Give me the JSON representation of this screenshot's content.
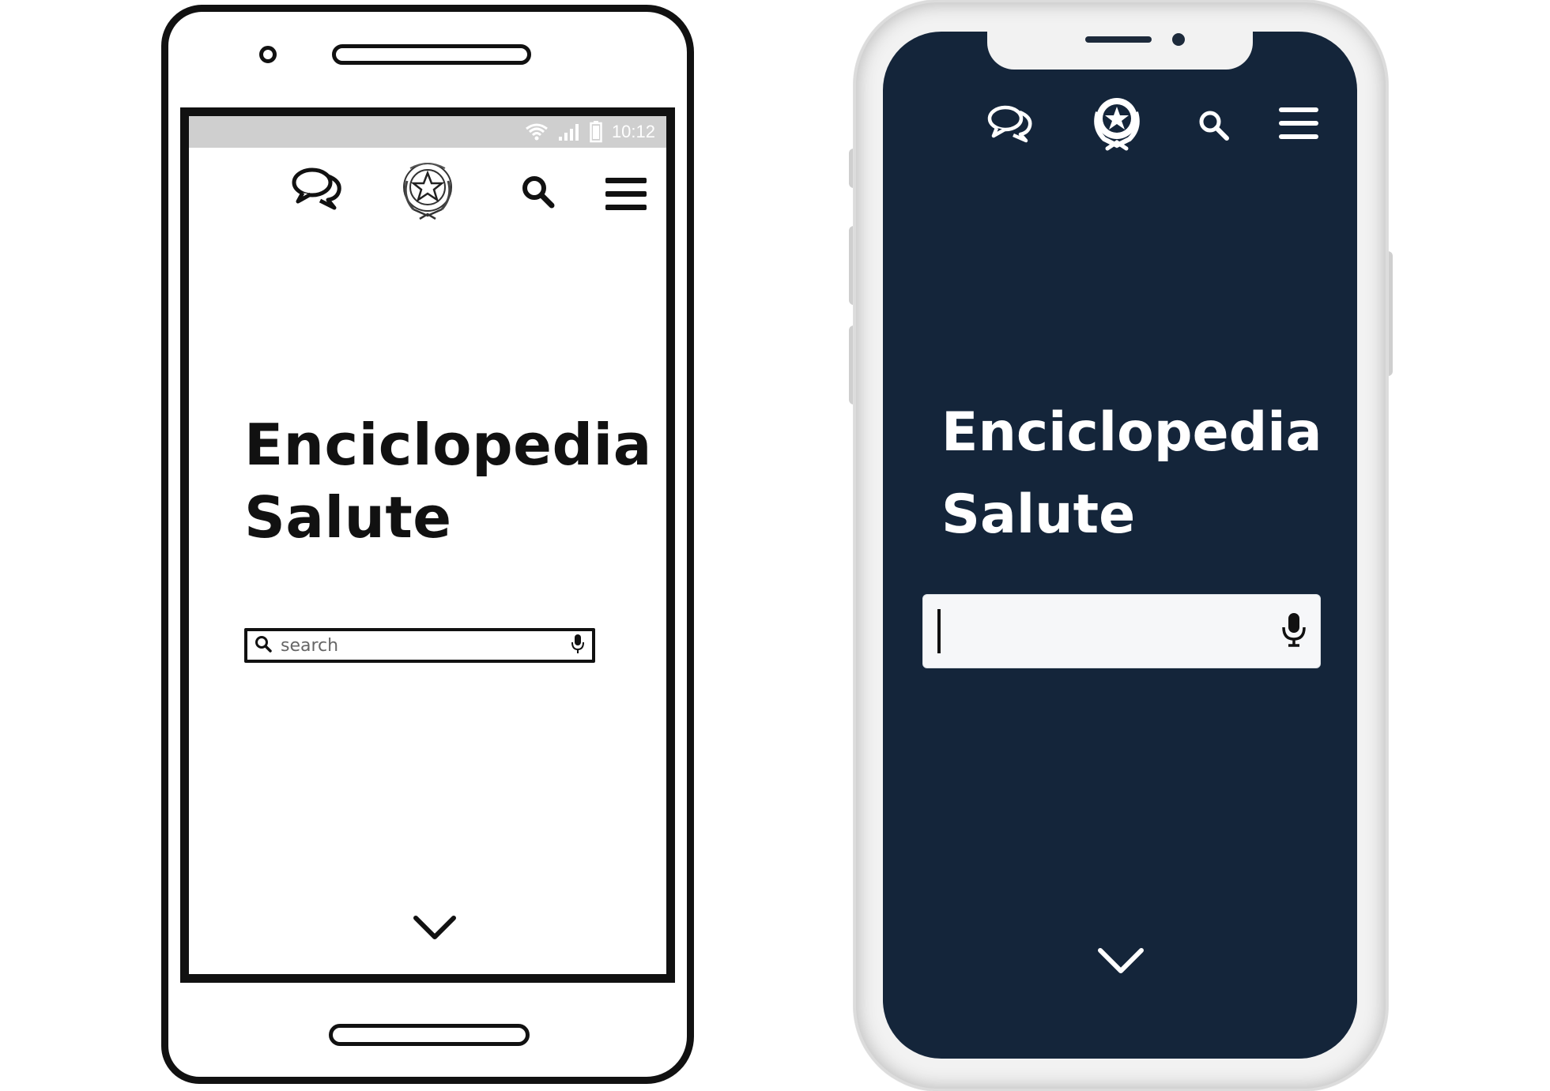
{
  "android": {
    "status_bar": {
      "time": "10:12"
    },
    "nav": {
      "chat_icon": "chat-bubbles-icon",
      "emblem_icon": "italian-republic-emblem-icon",
      "search_icon": "search-icon",
      "menu_icon": "hamburger-menu-icon"
    },
    "title_line1": "Enciclopedia",
    "title_line2": "Salute",
    "search": {
      "placeholder": "search",
      "value": ""
    },
    "scroll_icon": "chevron-down-icon"
  },
  "iphone": {
    "nav": {
      "chat_icon": "chat-bubbles-icon",
      "emblem_icon": "italian-republic-emblem-icon",
      "search_icon": "search-icon",
      "menu_icon": "hamburger-menu-icon"
    },
    "title_line1": "Enciclopedia",
    "title_line2": "Salute",
    "search": {
      "placeholder": "",
      "value": ""
    },
    "scroll_icon": "chevron-down-icon"
  },
  "colors": {
    "iphone_screen_bg": "#14253a",
    "iphone_text": "#ffffff",
    "wireframe_stroke": "#111111",
    "android_statusbar": "#cfcfcf"
  }
}
